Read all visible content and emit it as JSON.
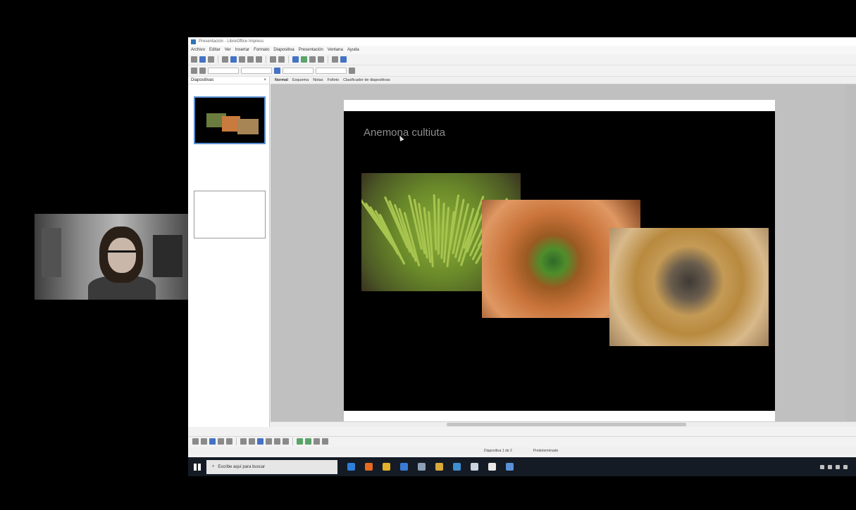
{
  "window": {
    "title": "Presentación - LibreOffice Impress",
    "menu": [
      "Archivo",
      "Editar",
      "Ver",
      "Insertar",
      "Formato",
      "Diapositiva",
      "Presentación",
      "Ventana",
      "Ayuda"
    ]
  },
  "slide_pane": {
    "title": "Diapositivas",
    "close": "×"
  },
  "view_tabs": [
    "Normal",
    "Esquema",
    "Notas",
    "Folleto",
    "Clasificador de diapositivas"
  ],
  "slide": {
    "title": "Anemona cultiuta"
  },
  "status": {
    "position": "Diapositiva 1 de 2",
    "layout": "Predeterminado"
  },
  "taskbar": {
    "search_placeholder": "Escribe aquí para buscar",
    "apps": [
      {
        "name": "edge",
        "color": "#2f7ed8"
      },
      {
        "name": "firefox",
        "color": "#e66a1f"
      },
      {
        "name": "files",
        "color": "#e3b12a"
      },
      {
        "name": "store",
        "color": "#3a7bd5"
      },
      {
        "name": "app5",
        "color": "#8ea0b6"
      },
      {
        "name": "chrome",
        "color": "#d9a93a"
      },
      {
        "name": "app7",
        "color": "#3f8fd0"
      },
      {
        "name": "app8",
        "color": "#c9d4e0"
      },
      {
        "name": "app9",
        "color": "#e8e8e8"
      },
      {
        "name": "app10",
        "color": "#5c8fd6"
      }
    ]
  }
}
